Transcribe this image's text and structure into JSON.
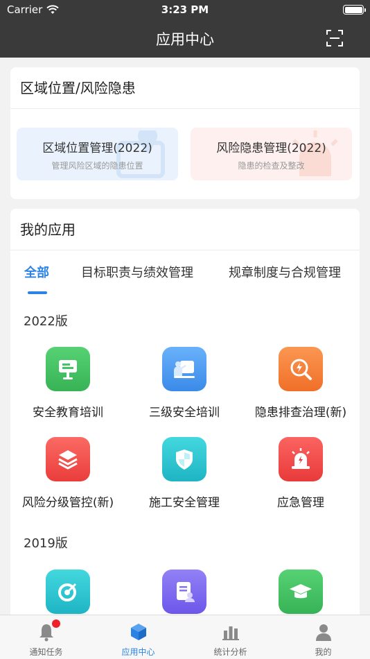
{
  "status_bar": {
    "carrier": "Carrier",
    "time": "3:23 PM",
    "battery_level": 1.0
  },
  "nav": {
    "title": "应用中心",
    "scan_icon": "scan-icon"
  },
  "risk_section": {
    "title": "区域位置/风险隐患",
    "tiles": [
      {
        "title": "区域位置管理(2022)",
        "subtitle": "管理风险区域的隐患位置"
      },
      {
        "title": "风险隐患管理(2022)",
        "subtitle": "隐患的检查及整改"
      }
    ]
  },
  "apps_section": {
    "title": "我的应用",
    "tabs": [
      {
        "label": "全部",
        "active": true
      },
      {
        "label": "目标职责与绩效管理",
        "active": false
      },
      {
        "label": "规章制度与合规管理",
        "active": false
      }
    ],
    "groups": [
      {
        "label": "2022版",
        "apps": [
          {
            "label": "安全教育培训",
            "icon": "training-board-icon",
            "color": "#45c463"
          },
          {
            "label": "三级安全培训",
            "icon": "teacher-board-icon",
            "color": "#4a9cf3"
          },
          {
            "label": "隐患排查治理(新)",
            "icon": "hazard-search-icon",
            "color": "#f7813a"
          },
          {
            "label": "风险分级管控(新)",
            "icon": "layers-icon",
            "color": "#f2514d"
          },
          {
            "label": "施工安全管理",
            "icon": "shield-icon",
            "color": "#2ec6d2"
          },
          {
            "label": "应急管理",
            "icon": "alarm-light-icon",
            "color": "#f04f4b"
          }
        ]
      },
      {
        "label": "2019版",
        "apps": [
          {
            "label": "",
            "icon": "target-icon",
            "color": "#2ec6d2"
          },
          {
            "label": "",
            "icon": "document-person-icon",
            "color": "#7f6cf0"
          },
          {
            "label": "",
            "icon": "graduation-cap-icon",
            "color": "#45c463"
          }
        ]
      }
    ]
  },
  "tab_bar": {
    "items": [
      {
        "label": "通知任务",
        "icon": "bell-icon",
        "active": false,
        "badge": true
      },
      {
        "label": "应用中心",
        "icon": "cube-icon",
        "active": true,
        "badge": false
      },
      {
        "label": "统计分析",
        "icon": "bar-chart-icon",
        "active": false,
        "badge": false
      },
      {
        "label": "我的",
        "icon": "person-icon",
        "active": false,
        "badge": false
      }
    ]
  },
  "colors": {
    "accent": "#2b83e5",
    "header_bg": "#3a3a3a",
    "badge": "#f0202a"
  }
}
